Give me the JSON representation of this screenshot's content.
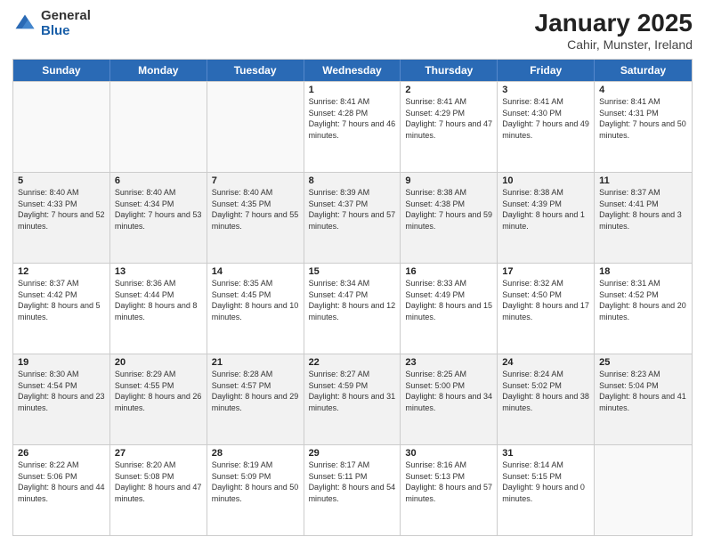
{
  "header": {
    "logo_general": "General",
    "logo_blue": "Blue",
    "title": "January 2025",
    "subtitle": "Cahir, Munster, Ireland"
  },
  "days_of_week": [
    "Sunday",
    "Monday",
    "Tuesday",
    "Wednesday",
    "Thursday",
    "Friday",
    "Saturday"
  ],
  "weeks": [
    [
      {
        "day": "",
        "info": ""
      },
      {
        "day": "",
        "info": ""
      },
      {
        "day": "",
        "info": ""
      },
      {
        "day": "1",
        "info": "Sunrise: 8:41 AM\nSunset: 4:28 PM\nDaylight: 7 hours and 46 minutes."
      },
      {
        "day": "2",
        "info": "Sunrise: 8:41 AM\nSunset: 4:29 PM\nDaylight: 7 hours and 47 minutes."
      },
      {
        "day": "3",
        "info": "Sunrise: 8:41 AM\nSunset: 4:30 PM\nDaylight: 7 hours and 49 minutes."
      },
      {
        "day": "4",
        "info": "Sunrise: 8:41 AM\nSunset: 4:31 PM\nDaylight: 7 hours and 50 minutes."
      }
    ],
    [
      {
        "day": "5",
        "info": "Sunrise: 8:40 AM\nSunset: 4:33 PM\nDaylight: 7 hours and 52 minutes."
      },
      {
        "day": "6",
        "info": "Sunrise: 8:40 AM\nSunset: 4:34 PM\nDaylight: 7 hours and 53 minutes."
      },
      {
        "day": "7",
        "info": "Sunrise: 8:40 AM\nSunset: 4:35 PM\nDaylight: 7 hours and 55 minutes."
      },
      {
        "day": "8",
        "info": "Sunrise: 8:39 AM\nSunset: 4:37 PM\nDaylight: 7 hours and 57 minutes."
      },
      {
        "day": "9",
        "info": "Sunrise: 8:38 AM\nSunset: 4:38 PM\nDaylight: 7 hours and 59 minutes."
      },
      {
        "day": "10",
        "info": "Sunrise: 8:38 AM\nSunset: 4:39 PM\nDaylight: 8 hours and 1 minute."
      },
      {
        "day": "11",
        "info": "Sunrise: 8:37 AM\nSunset: 4:41 PM\nDaylight: 8 hours and 3 minutes."
      }
    ],
    [
      {
        "day": "12",
        "info": "Sunrise: 8:37 AM\nSunset: 4:42 PM\nDaylight: 8 hours and 5 minutes."
      },
      {
        "day": "13",
        "info": "Sunrise: 8:36 AM\nSunset: 4:44 PM\nDaylight: 8 hours and 8 minutes."
      },
      {
        "day": "14",
        "info": "Sunrise: 8:35 AM\nSunset: 4:45 PM\nDaylight: 8 hours and 10 minutes."
      },
      {
        "day": "15",
        "info": "Sunrise: 8:34 AM\nSunset: 4:47 PM\nDaylight: 8 hours and 12 minutes."
      },
      {
        "day": "16",
        "info": "Sunrise: 8:33 AM\nSunset: 4:49 PM\nDaylight: 8 hours and 15 minutes."
      },
      {
        "day": "17",
        "info": "Sunrise: 8:32 AM\nSunset: 4:50 PM\nDaylight: 8 hours and 17 minutes."
      },
      {
        "day": "18",
        "info": "Sunrise: 8:31 AM\nSunset: 4:52 PM\nDaylight: 8 hours and 20 minutes."
      }
    ],
    [
      {
        "day": "19",
        "info": "Sunrise: 8:30 AM\nSunset: 4:54 PM\nDaylight: 8 hours and 23 minutes."
      },
      {
        "day": "20",
        "info": "Sunrise: 8:29 AM\nSunset: 4:55 PM\nDaylight: 8 hours and 26 minutes."
      },
      {
        "day": "21",
        "info": "Sunrise: 8:28 AM\nSunset: 4:57 PM\nDaylight: 8 hours and 29 minutes."
      },
      {
        "day": "22",
        "info": "Sunrise: 8:27 AM\nSunset: 4:59 PM\nDaylight: 8 hours and 31 minutes."
      },
      {
        "day": "23",
        "info": "Sunrise: 8:25 AM\nSunset: 5:00 PM\nDaylight: 8 hours and 34 minutes."
      },
      {
        "day": "24",
        "info": "Sunrise: 8:24 AM\nSunset: 5:02 PM\nDaylight: 8 hours and 38 minutes."
      },
      {
        "day": "25",
        "info": "Sunrise: 8:23 AM\nSunset: 5:04 PM\nDaylight: 8 hours and 41 minutes."
      }
    ],
    [
      {
        "day": "26",
        "info": "Sunrise: 8:22 AM\nSunset: 5:06 PM\nDaylight: 8 hours and 44 minutes."
      },
      {
        "day": "27",
        "info": "Sunrise: 8:20 AM\nSunset: 5:08 PM\nDaylight: 8 hours and 47 minutes."
      },
      {
        "day": "28",
        "info": "Sunrise: 8:19 AM\nSunset: 5:09 PM\nDaylight: 8 hours and 50 minutes."
      },
      {
        "day": "29",
        "info": "Sunrise: 8:17 AM\nSunset: 5:11 PM\nDaylight: 8 hours and 54 minutes."
      },
      {
        "day": "30",
        "info": "Sunrise: 8:16 AM\nSunset: 5:13 PM\nDaylight: 8 hours and 57 minutes."
      },
      {
        "day": "31",
        "info": "Sunrise: 8:14 AM\nSunset: 5:15 PM\nDaylight: 9 hours and 0 minutes."
      },
      {
        "day": "",
        "info": ""
      }
    ]
  ]
}
